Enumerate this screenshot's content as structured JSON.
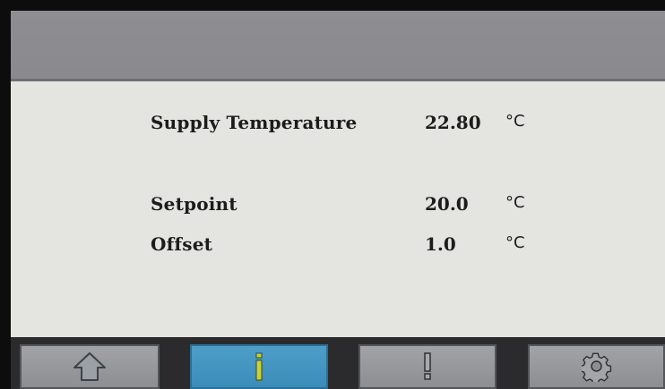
{
  "readings": {
    "supply": {
      "label": "Supply Temperature",
      "value": "22.80",
      "unit": "°C"
    },
    "setpoint": {
      "label": "Setpoint",
      "value": "20.0",
      "unit": "°C"
    },
    "offset": {
      "label": "Offset",
      "value": "1.0",
      "unit": "°C"
    }
  },
  "nav": {
    "items": [
      {
        "name": "home",
        "icon": "home-icon",
        "active": false
      },
      {
        "name": "info",
        "icon": "info-icon",
        "active": true
      },
      {
        "name": "alarm",
        "icon": "exclamation-icon",
        "active": false
      },
      {
        "name": "settings",
        "icon": "gear-icon",
        "active": false
      }
    ]
  },
  "colors": {
    "header": "#8c8c90",
    "content_bg": "#e4e4e0",
    "active_button": "#4396c1",
    "button": "#9a9b9f",
    "text": "#1c1c1c"
  }
}
